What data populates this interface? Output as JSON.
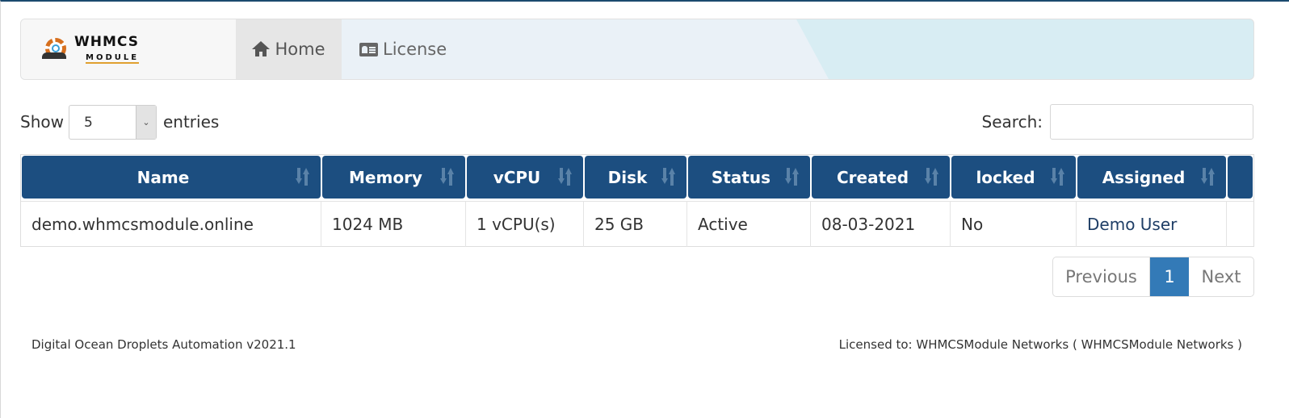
{
  "brand": {
    "line1": "WHMCS",
    "line2": "MODULE",
    "alt": "WHMCS Module logo"
  },
  "nav": {
    "items": [
      {
        "label": "Home",
        "icon": "home-icon",
        "active": true
      },
      {
        "label": "License",
        "icon": "id-card-icon",
        "active": false
      }
    ]
  },
  "controls": {
    "show_label": "Show",
    "entries_label": "entries",
    "page_length": "5",
    "search_label": "Search:",
    "search_value": "",
    "search_placeholder": ""
  },
  "table": {
    "columns": [
      "Name",
      "Memory",
      "vCPU",
      "Disk",
      "Status",
      "Created",
      "locked",
      "Assigned",
      ""
    ],
    "rows": [
      {
        "name": "demo.whmcsmodule.online",
        "memory": "1024 MB",
        "vcpu": "1 vCPU(s)",
        "disk": "25 GB",
        "status": "Active",
        "created": "08-03-2021",
        "locked": "No",
        "assigned": "Demo User",
        "actions": ""
      }
    ]
  },
  "pagination": {
    "previous": "Previous",
    "current": "1",
    "next": "Next"
  },
  "footer": {
    "version": "Digital Ocean Droplets Automation v2021.1",
    "license": "Licensed to: WHMCSModule Networks ( WHMCSModule Networks )"
  },
  "colors": {
    "header_bg": "#1c4e80",
    "active_page": "#337ab7",
    "top_border": "#1b4a6e",
    "navbar_bg": "#d8edf3"
  }
}
